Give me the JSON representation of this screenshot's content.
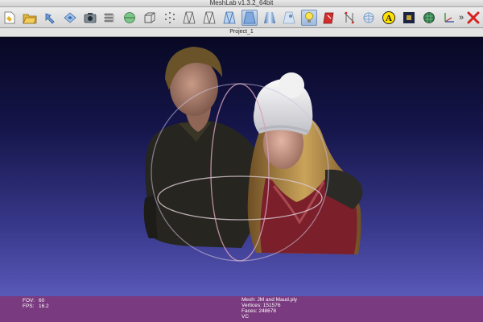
{
  "window": {
    "title": "MeshLab v1.3.2_64bit"
  },
  "project": {
    "name": "Project_1"
  },
  "toolbar": {
    "buttons": [
      {
        "icon": "new-project-icon"
      },
      {
        "icon": "open-icon"
      },
      {
        "icon": "reload-icon"
      },
      {
        "icon": "save-icon"
      },
      {
        "icon": "snapshot-icon"
      },
      {
        "icon": "layers-icon"
      },
      {
        "icon": "globe-icon"
      },
      {
        "icon": "bounding-box-icon"
      },
      {
        "icon": "points-icon"
      },
      {
        "icon": "wireframe-icon"
      },
      {
        "icon": "hidden-lines-icon"
      },
      {
        "icon": "flat-lines-icon"
      },
      {
        "icon": "flat-shading-icon",
        "active": true
      },
      {
        "icon": "smooth-shading-icon"
      },
      {
        "icon": "texture-icon"
      },
      {
        "icon": "light-bulb-icon",
        "active": true
      },
      {
        "icon": "color-select-icon"
      },
      {
        "icon": "measure-icon"
      },
      {
        "icon": "trackball-icon"
      },
      {
        "icon": "annotation-icon",
        "label": "A"
      },
      {
        "icon": "render-icon"
      },
      {
        "icon": "decorate-icon"
      },
      {
        "icon": "axes-icon"
      },
      {
        "icon": "delete-icon"
      }
    ],
    "overflow_label": "»"
  },
  "info": {
    "fov_label": "FOV:",
    "fov": "60",
    "fps_label": "FPS:",
    "fps": "16.2",
    "mesh_label": "Mesh:",
    "mesh": "JM and Maud.ply",
    "vertices_label": "Vertices:",
    "vertices": "151576",
    "faces_label": "Faces:",
    "faces": "248678",
    "color_mode": "VC"
  }
}
